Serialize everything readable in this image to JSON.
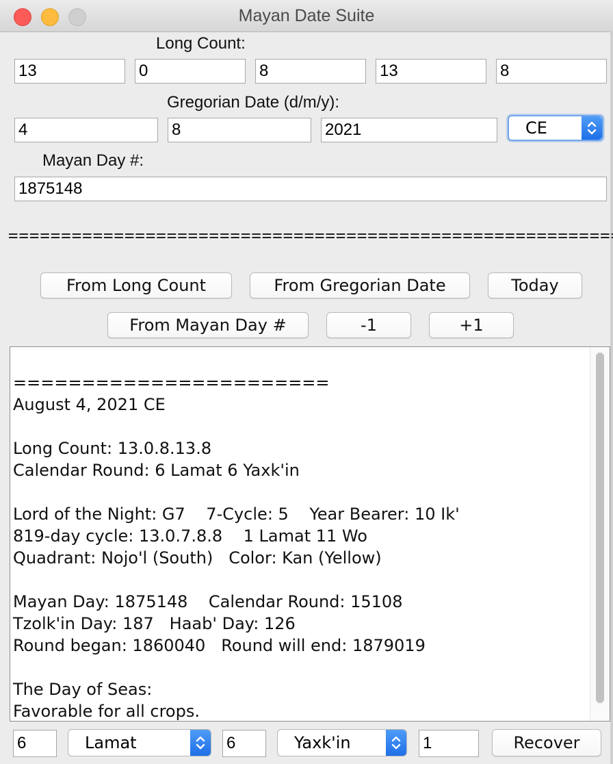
{
  "window": {
    "title": "Mayan Date Suite"
  },
  "long_count": {
    "label": "Long Count:",
    "values": [
      "13",
      "0",
      "8",
      "13",
      "8"
    ]
  },
  "gregorian": {
    "label": "Gregorian Date (d/m/y):",
    "day": "4",
    "month": "8",
    "year": "2021",
    "era": "CE"
  },
  "mayan_day": {
    "label": "Mayan Day #:",
    "value": "1875148"
  },
  "separator": "==========================================================",
  "buttons": {
    "from_long_count": "From Long Count",
    "from_gregorian": "From Gregorian Date",
    "today": "Today",
    "from_mayan_day": "From Mayan Day #",
    "minus_one": "-1",
    "plus_one": "+1"
  },
  "output": {
    "lines": [
      "=======================",
      "August 4, 2021 CE",
      "",
      "Long Count: 13.0.8.13.8",
      "Calendar Round: 6 Lamat 6 Yaxk'in",
      "",
      "Lord of the Night: G7    7-Cycle: 5    Year Bearer: 10 Ik'",
      "819-day cycle: 13.0.7.8.8    1 Lamat 11 Wo",
      "Quadrant: Nojo'l (South)   Color: Kan (Yellow)",
      "",
      "Mayan Day: 1875148    Calendar Round: 15108",
      "Tzolk'in Day: 187   Haab' Day: 126",
      "Round began: 1860040   Round will end: 1879019",
      "",
      "The Day of Seas:",
      "Favorable for all crops."
    ]
  },
  "bottom": {
    "tzolkin_number": "6",
    "tzolkin_name": "Lamat",
    "haab_number": "6",
    "haab_month": "Yaxk'in",
    "cycle": "1",
    "recover": "Recover"
  },
  "colors": {
    "select_accent": "#1f6fe8",
    "close": "#fc5b57",
    "minimize": "#fdbc40"
  }
}
